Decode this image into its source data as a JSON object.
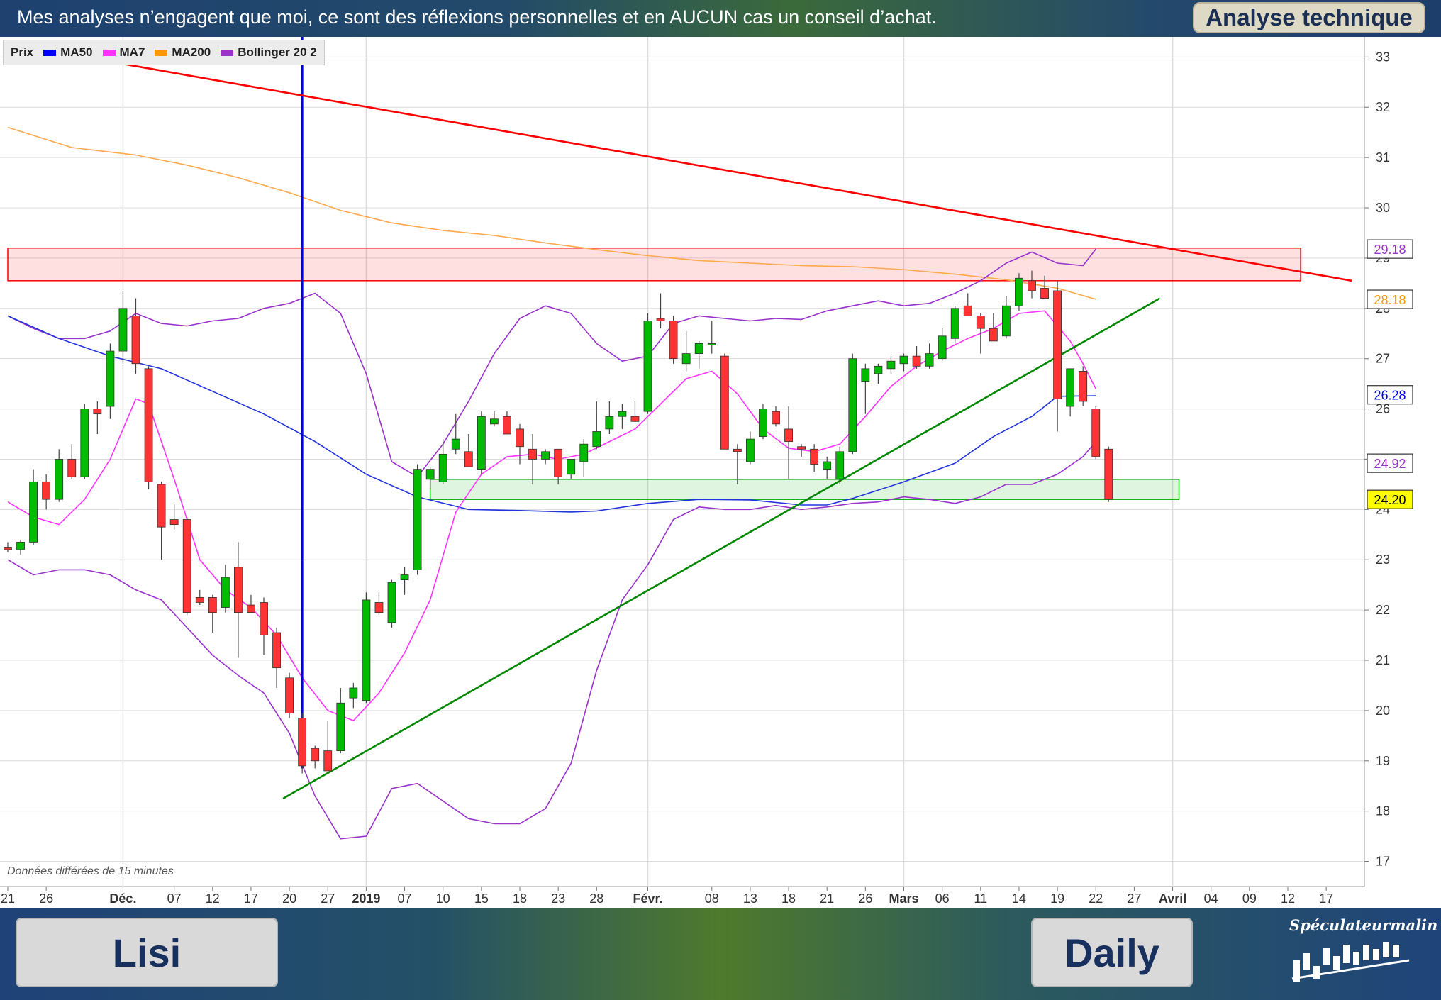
{
  "header": {
    "disclaimer": "Mes analyses n’engagent que moi, ce sont des réflexions personnelles  et en AUCUN cas un conseil d’achat.",
    "tag": "Analyse technique"
  },
  "footer": {
    "ticker": "Lisi",
    "timeframe": "Daily",
    "logo": "Spéculateurmalin"
  },
  "chart_note": "Données différées de 15 minutes",
  "legend": [
    {
      "label": "Prix",
      "color": null
    },
    {
      "label": "MA50",
      "color": "#0000ff"
    },
    {
      "label": "MA7",
      "color": "#ff33ff"
    },
    {
      "label": "MA200",
      "color": "#ff9900"
    },
    {
      "label": "Bollinger 20 2",
      "color": "#9933cc"
    }
  ],
  "chart_data": {
    "type": "candlestick",
    "ylim": [
      16.5,
      33.4
    ],
    "y_ticks": [
      "17",
      "18",
      "19",
      "20",
      "21",
      "22",
      "23",
      "24",
      "25",
      "26",
      "27",
      "28",
      "29",
      "30",
      "31",
      "32",
      "33"
    ],
    "x_labels": [
      {
        "label": "21",
        "index": 0,
        "bold": false
      },
      {
        "label": "26",
        "index": 3,
        "bold": false
      },
      {
        "label": "Déc.",
        "index": 9,
        "bold": true
      },
      {
        "label": "07",
        "index": 13,
        "bold": false
      },
      {
        "label": "12",
        "index": 16,
        "bold": false
      },
      {
        "label": "17",
        "index": 19,
        "bold": false
      },
      {
        "label": "20",
        "index": 22,
        "bold": false
      },
      {
        "label": "27",
        "index": 25,
        "bold": false
      },
      {
        "label": "2019",
        "index": 28,
        "bold": true
      },
      {
        "label": "07",
        "index": 31,
        "bold": false
      },
      {
        "label": "10",
        "index": 34,
        "bold": false
      },
      {
        "label": "15",
        "index": 37,
        "bold": false
      },
      {
        "label": "18",
        "index": 40,
        "bold": false
      },
      {
        "label": "23",
        "index": 43,
        "bold": false
      },
      {
        "label": "28",
        "index": 46,
        "bold": false
      },
      {
        "label": "Févr.",
        "index": 50,
        "bold": true
      },
      {
        "label": "08",
        "index": 55,
        "bold": false
      },
      {
        "label": "13",
        "index": 58,
        "bold": false
      },
      {
        "label": "18",
        "index": 61,
        "bold": false
      },
      {
        "label": "21",
        "index": 64,
        "bold": false
      },
      {
        "label": "26",
        "index": 67,
        "bold": false
      },
      {
        "label": "Mars",
        "index": 70,
        "bold": true
      },
      {
        "label": "06",
        "index": 73,
        "bold": false
      },
      {
        "label": "11",
        "index": 76,
        "bold": false
      },
      {
        "label": "14",
        "index": 79,
        "bold": false
      },
      {
        "label": "19",
        "index": 82,
        "bold": false
      },
      {
        "label": "22",
        "index": 85,
        "bold": false
      },
      {
        "label": "27",
        "index": 88,
        "bold": false
      },
      {
        "label": "Avril",
        "index": 91,
        "bold": true
      },
      {
        "label": "04",
        "index": 94,
        "bold": false
      },
      {
        "label": "09",
        "index": 97,
        "bold": false
      },
      {
        "label": "12",
        "index": 100,
        "bold": false
      },
      {
        "label": "17",
        "index": 103,
        "bold": false
      }
    ],
    "candles": [
      [
        23.25,
        23.35,
        23.15,
        23.2
      ],
      [
        23.2,
        23.4,
        23.1,
        23.35
      ],
      [
        23.35,
        24.8,
        23.3,
        24.55
      ],
      [
        24.55,
        24.7,
        24.0,
        24.2
      ],
      [
        24.2,
        25.2,
        24.15,
        25.0
      ],
      [
        25.0,
        25.3,
        24.6,
        24.65
      ],
      [
        24.65,
        26.1,
        24.6,
        26.0
      ],
      [
        26.0,
        26.15,
        25.5,
        25.9
      ],
      [
        26.05,
        27.3,
        25.8,
        27.15
      ],
      [
        27.15,
        28.35,
        26.9,
        28.0
      ],
      [
        27.85,
        28.2,
        26.7,
        26.9
      ],
      [
        26.8,
        26.85,
        24.4,
        24.55
      ],
      [
        24.5,
        24.55,
        23.0,
        23.65
      ],
      [
        23.8,
        24.1,
        23.6,
        23.7
      ],
      [
        23.8,
        23.85,
        21.9,
        21.95
      ],
      [
        22.25,
        22.4,
        22.1,
        22.15
      ],
      [
        22.25,
        22.3,
        21.55,
        21.95
      ],
      [
        22.05,
        22.9,
        21.95,
        22.65
      ],
      [
        22.85,
        23.35,
        21.05,
        21.95
      ],
      [
        22.1,
        22.3,
        21.95,
        21.95
      ],
      [
        22.15,
        22.25,
        21.1,
        21.5
      ],
      [
        21.55,
        21.65,
        20.45,
        20.85
      ],
      [
        20.65,
        20.75,
        19.85,
        19.95
      ],
      [
        19.85,
        19.95,
        18.75,
        18.9
      ],
      [
        19.25,
        19.3,
        18.85,
        19.0
      ],
      [
        19.2,
        19.8,
        18.8,
        18.8
      ],
      [
        19.2,
        20.45,
        19.15,
        20.15
      ],
      [
        20.25,
        20.55,
        20.05,
        20.45
      ],
      [
        20.2,
        22.35,
        20.15,
        22.2
      ],
      [
        22.15,
        22.35,
        21.9,
        21.95
      ],
      [
        21.75,
        22.6,
        21.65,
        22.55
      ],
      [
        22.6,
        22.85,
        22.3,
        22.7
      ],
      [
        22.8,
        24.9,
        22.7,
        24.8
      ],
      [
        24.6,
        24.85,
        24.4,
        24.8
      ],
      [
        24.55,
        25.4,
        24.5,
        25.1
      ],
      [
        25.2,
        25.9,
        25.1,
        25.4
      ],
      [
        25.15,
        25.5,
        24.85,
        24.85
      ],
      [
        24.8,
        25.95,
        24.7,
        25.85
      ],
      [
        25.7,
        25.95,
        25.65,
        25.8
      ],
      [
        25.85,
        25.95,
        25.5,
        25.5
      ],
      [
        25.6,
        25.7,
        24.9,
        25.25
      ],
      [
        25.2,
        25.5,
        24.5,
        25.0
      ],
      [
        25.0,
        25.2,
        24.9,
        25.15
      ],
      [
        25.2,
        25.2,
        24.5,
        24.65
      ],
      [
        24.7,
        24.8,
        24.6,
        25.0
      ],
      [
        24.95,
        25.4,
        24.65,
        25.3
      ],
      [
        25.25,
        26.15,
        25.2,
        25.55
      ],
      [
        25.6,
        26.15,
        25.5,
        25.85
      ],
      [
        25.85,
        26.1,
        25.6,
        25.95
      ],
      [
        25.85,
        26.15,
        25.75,
        25.75
      ],
      [
        25.95,
        27.9,
        25.9,
        27.75
      ],
      [
        27.8,
        28.3,
        27.6,
        27.75
      ],
      [
        27.75,
        27.85,
        26.9,
        27.0
      ],
      [
        26.9,
        27.55,
        26.75,
        27.1
      ],
      [
        27.1,
        27.35,
        26.8,
        27.3
      ],
      [
        27.3,
        27.75,
        27.1,
        27.3
      ],
      [
        27.05,
        27.1,
        25.8,
        25.2
      ],
      [
        25.2,
        25.3,
        24.5,
        25.15
      ],
      [
        24.95,
        25.55,
        24.9,
        25.4
      ],
      [
        25.45,
        26.1,
        25.4,
        26.0
      ],
      [
        25.95,
        26.05,
        25.65,
        25.7
      ],
      [
        25.6,
        26.05,
        24.6,
        25.35
      ],
      [
        25.25,
        25.3,
        25.05,
        25.2
      ],
      [
        25.2,
        25.3,
        24.75,
        24.9
      ],
      [
        24.8,
        25.05,
        24.6,
        24.95
      ],
      [
        24.6,
        25.25,
        24.5,
        25.15
      ],
      [
        25.15,
        27.1,
        25.1,
        27.0
      ],
      [
        26.55,
        26.9,
        25.9,
        26.8
      ],
      [
        26.7,
        26.9,
        26.5,
        26.85
      ],
      [
        26.8,
        27.05,
        26.7,
        26.95
      ],
      [
        26.9,
        27.1,
        26.75,
        27.05
      ],
      [
        27.05,
        27.25,
        26.8,
        26.85
      ],
      [
        26.85,
        27.3,
        26.8,
        27.1
      ],
      [
        27.0,
        27.6,
        26.95,
        27.45
      ],
      [
        27.4,
        28.05,
        27.3,
        28.0
      ],
      [
        28.05,
        28.3,
        27.9,
        27.85
      ],
      [
        27.85,
        27.9,
        27.1,
        27.6
      ],
      [
        27.6,
        27.9,
        27.45,
        27.35
      ],
      [
        27.45,
        28.25,
        27.4,
        28.05
      ],
      [
        28.05,
        28.7,
        27.95,
        28.6
      ],
      [
        28.55,
        28.75,
        28.2,
        28.35
      ],
      [
        28.4,
        28.65,
        28.2,
        28.2
      ],
      [
        28.35,
        28.55,
        25.55,
        26.2
      ],
      [
        26.05,
        26.8,
        25.85,
        26.8
      ],
      [
        26.75,
        26.85,
        26.05,
        26.15
      ],
      [
        26.0,
        26.05,
        25.0,
        25.05
      ],
      [
        25.2,
        25.25,
        24.15,
        24.2
      ]
    ],
    "ma50": [
      [
        0,
        27.85
      ],
      [
        4,
        27.4
      ],
      [
        8,
        27.05
      ],
      [
        12,
        26.8
      ],
      [
        16,
        26.35
      ],
      [
        20,
        25.9
      ],
      [
        24,
        25.35
      ],
      [
        28,
        24.7
      ],
      [
        32,
        24.25
      ],
      [
        36,
        24.0
      ],
      [
        40,
        23.98
      ],
      [
        44,
        23.95
      ],
      [
        46,
        23.97
      ],
      [
        50,
        24.12
      ],
      [
        54,
        24.2
      ],
      [
        58,
        24.19
      ],
      [
        62,
        24.09
      ],
      [
        64,
        24.09
      ],
      [
        66,
        24.22
      ],
      [
        70,
        24.55
      ],
      [
        74,
        24.92
      ],
      [
        77,
        25.45
      ],
      [
        80,
        25.85
      ],
      [
        82,
        26.25
      ],
      [
        85,
        26.26
      ]
    ],
    "ma7": [
      [
        0,
        24.15
      ],
      [
        2,
        23.85
      ],
      [
        4,
        23.7
      ],
      [
        6,
        24.2
      ],
      [
        8,
        25.0
      ],
      [
        10,
        26.2
      ],
      [
        11,
        26.1
      ],
      [
        13,
        24.6
      ],
      [
        15,
        23.0
      ],
      [
        17,
        22.4
      ],
      [
        19,
        22.05
      ],
      [
        21,
        21.5
      ],
      [
        23,
        20.65
      ],
      [
        25,
        20.0
      ],
      [
        27,
        19.8
      ],
      [
        29,
        20.35
      ],
      [
        31,
        21.15
      ],
      [
        33,
        22.2
      ],
      [
        35,
        23.95
      ],
      [
        37,
        24.7
      ],
      [
        39,
        25.05
      ],
      [
        41,
        25.1
      ],
      [
        43,
        25.0
      ],
      [
        45,
        25.1
      ],
      [
        47,
        25.35
      ],
      [
        49,
        25.6
      ],
      [
        51,
        26.1
      ],
      [
        53,
        26.6
      ],
      [
        55,
        26.75
      ],
      [
        57,
        26.3
      ],
      [
        59,
        25.6
      ],
      [
        61,
        25.22
      ],
      [
        63,
        25.15
      ],
      [
        65,
        25.3
      ],
      [
        67,
        25.85
      ],
      [
        69,
        26.45
      ],
      [
        71,
        26.85
      ],
      [
        73,
        27.15
      ],
      [
        75,
        27.4
      ],
      [
        77,
        27.6
      ],
      [
        79,
        27.9
      ],
      [
        81,
        27.95
      ],
      [
        83,
        27.35
      ],
      [
        84,
        26.9
      ],
      [
        85,
        26.4
      ]
    ],
    "ma200": [
      [
        0,
        31.6
      ],
      [
        5,
        31.2
      ],
      [
        10,
        31.05
      ],
      [
        14,
        30.85
      ],
      [
        18,
        30.6
      ],
      [
        22,
        30.3
      ],
      [
        26,
        29.95
      ],
      [
        30,
        29.7
      ],
      [
        34,
        29.55
      ],
      [
        38,
        29.45
      ],
      [
        42,
        29.3
      ],
      [
        46,
        29.17
      ],
      [
        50,
        29.05
      ],
      [
        54,
        28.95
      ],
      [
        58,
        28.9
      ],
      [
        62,
        28.85
      ],
      [
        66,
        28.83
      ],
      [
        70,
        28.77
      ],
      [
        74,
        28.68
      ],
      [
        78,
        28.57
      ],
      [
        82,
        28.4
      ],
      [
        85,
        28.18
      ]
    ],
    "bollinger_upper": [
      [
        0,
        27.85
      ],
      [
        2,
        27.6
      ],
      [
        4,
        27.4
      ],
      [
        6,
        27.4
      ],
      [
        8,
        27.55
      ],
      [
        10,
        27.9
      ],
      [
        12,
        27.7
      ],
      [
        14,
        27.65
      ],
      [
        16,
        27.75
      ],
      [
        18,
        27.8
      ],
      [
        20,
        28.0
      ],
      [
        22,
        28.1
      ],
      [
        24,
        28.3
      ],
      [
        26,
        27.9
      ],
      [
        28,
        26.7
      ],
      [
        30,
        24.95
      ],
      [
        32,
        24.65
      ],
      [
        34,
        25.3
      ],
      [
        36,
        26.15
      ],
      [
        38,
        27.1
      ],
      [
        40,
        27.8
      ],
      [
        42,
        28.05
      ],
      [
        44,
        27.9
      ],
      [
        46,
        27.3
      ],
      [
        48,
        26.95
      ],
      [
        50,
        27.05
      ],
      [
        52,
        27.7
      ],
      [
        54,
        27.85
      ],
      [
        56,
        27.8
      ],
      [
        58,
        27.75
      ],
      [
        60,
        27.8
      ],
      [
        62,
        27.78
      ],
      [
        64,
        27.95
      ],
      [
        66,
        28.05
      ],
      [
        68,
        28.15
      ],
      [
        70,
        28.05
      ],
      [
        72,
        28.1
      ],
      [
        74,
        28.3
      ],
      [
        76,
        28.55
      ],
      [
        78,
        28.9
      ],
      [
        80,
        29.12
      ],
      [
        82,
        28.9
      ],
      [
        84,
        28.85
      ],
      [
        85,
        29.18
      ]
    ],
    "bollinger_lower": [
      [
        0,
        23.0
      ],
      [
        2,
        22.7
      ],
      [
        4,
        22.8
      ],
      [
        6,
        22.8
      ],
      [
        8,
        22.7
      ],
      [
        10,
        22.4
      ],
      [
        12,
        22.2
      ],
      [
        14,
        21.65
      ],
      [
        16,
        21.1
      ],
      [
        18,
        20.7
      ],
      [
        20,
        20.35
      ],
      [
        22,
        19.55
      ],
      [
        24,
        18.3
      ],
      [
        26,
        17.45
      ],
      [
        28,
        17.5
      ],
      [
        30,
        18.45
      ],
      [
        32,
        18.55
      ],
      [
        34,
        18.2
      ],
      [
        36,
        17.85
      ],
      [
        38,
        17.75
      ],
      [
        40,
        17.75
      ],
      [
        42,
        18.05
      ],
      [
        44,
        18.95
      ],
      [
        46,
        20.8
      ],
      [
        48,
        22.2
      ],
      [
        50,
        22.9
      ],
      [
        52,
        23.8
      ],
      [
        54,
        24.05
      ],
      [
        56,
        24.0
      ],
      [
        58,
        24.0
      ],
      [
        60,
        24.08
      ],
      [
        62,
        24.0
      ],
      [
        64,
        24.05
      ],
      [
        66,
        24.12
      ],
      [
        68,
        24.15
      ],
      [
        70,
        24.25
      ],
      [
        72,
        24.2
      ],
      [
        74,
        24.12
      ],
      [
        76,
        24.25
      ],
      [
        78,
        24.5
      ],
      [
        80,
        24.5
      ],
      [
        82,
        24.7
      ],
      [
        84,
        25.05
      ],
      [
        85,
        25.35
      ]
    ],
    "trendlines": [
      {
        "color": "#ff0000",
        "points": [
          [
            1.5,
            33.2
          ],
          [
            105,
            28.55
          ]
        ]
      },
      {
        "color": "#008800",
        "points": [
          [
            21.5,
            18.25
          ],
          [
            90,
            28.2
          ]
        ]
      }
    ],
    "vertical_marker": {
      "index": 23,
      "color": "#0000dd"
    },
    "zones": [
      {
        "from": 0,
        "to": 101,
        "ymin": 28.55,
        "ymax": 29.2,
        "color": "#ff0000"
      },
      {
        "from": 33,
        "to": 91.5,
        "ymin": 24.2,
        "ymax": 24.6,
        "color": "#00aa00"
      }
    ],
    "value_labels": [
      {
        "text": "29.18",
        "value": 29.18,
        "color": "#9933cc",
        "fill": "#ffffff"
      },
      {
        "text": "28.18",
        "value": 28.18,
        "color": "#ff9900",
        "fill": "#ffffff"
      },
      {
        "text": "26.28",
        "value": 26.28,
        "color": "#0000ff",
        "fill": "#ffffff"
      },
      {
        "text": "24.92",
        "value": 24.92,
        "color": "#9933cc",
        "fill": "#ffffff"
      },
      {
        "text": "24.20",
        "value": 24.2,
        "color": "#000000",
        "fill": "#ffff00"
      }
    ],
    "colors": {
      "up": "#00bb00",
      "down": "#ff3333",
      "grid": "#dcdcdc"
    }
  }
}
